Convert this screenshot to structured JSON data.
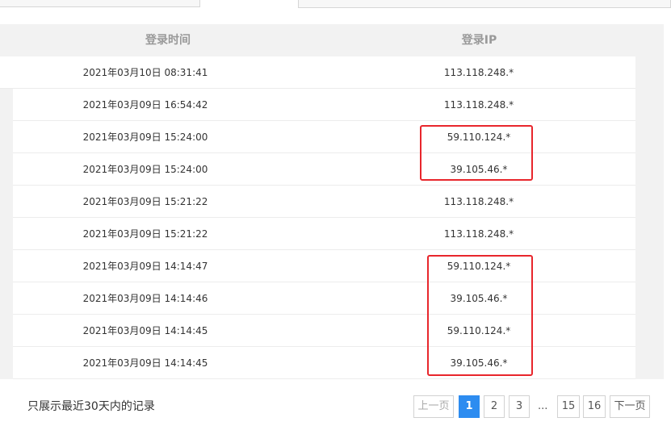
{
  "table": {
    "headers": {
      "time": "登录时间",
      "ip": "登录IP"
    },
    "rows": [
      {
        "time": "2021年03月10日 08:31:41",
        "ip": "113.118.248.*"
      },
      {
        "time": "2021年03月09日 16:54:42",
        "ip": "113.118.248.*"
      },
      {
        "time": "2021年03月09日 15:24:00",
        "ip": "59.110.124.*"
      },
      {
        "time": "2021年03月09日 15:24:00",
        "ip": "39.105.46.*"
      },
      {
        "time": "2021年03月09日 15:21:22",
        "ip": "113.118.248.*"
      },
      {
        "time": "2021年03月09日 15:21:22",
        "ip": "113.118.248.*"
      },
      {
        "time": "2021年03月09日 14:14:47",
        "ip": "59.110.124.*"
      },
      {
        "time": "2021年03月09日 14:14:46",
        "ip": "39.105.46.*"
      },
      {
        "time": "2021年03月09日 14:14:45",
        "ip": "59.110.124.*"
      },
      {
        "time": "2021年03月09日 14:14:45",
        "ip": "39.105.46.*"
      }
    ]
  },
  "footer": {
    "note": "只展示最近30天内的记录"
  },
  "pagination": {
    "prev": "上一页",
    "pages": [
      "1",
      "2",
      "3"
    ],
    "ellipsis": "...",
    "tail_pages": [
      "15",
      "16"
    ],
    "next": "下一页",
    "current": "1"
  },
  "colors": {
    "highlight": "#e8262c",
    "active_page": "#2d8cf0"
  }
}
